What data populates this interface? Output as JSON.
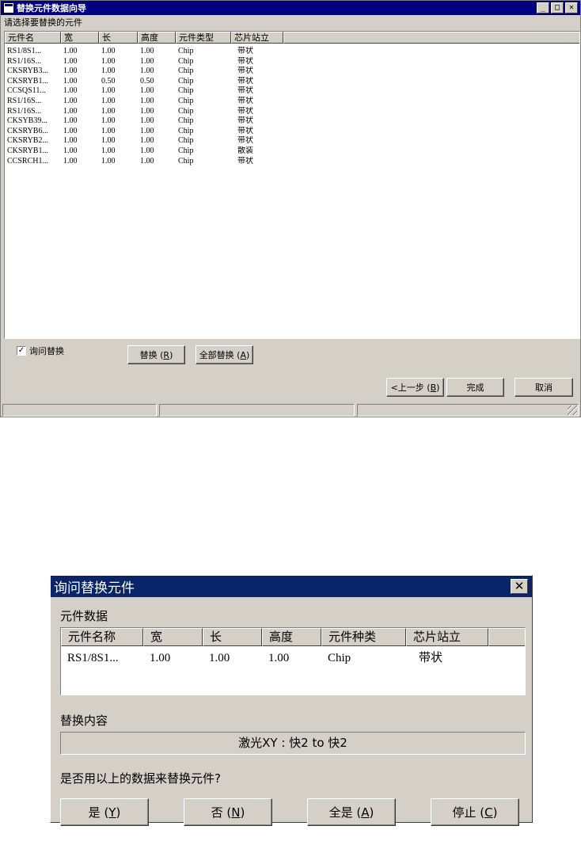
{
  "wizard": {
    "title": "替换元件数据向导",
    "prompt": "请选择要替换的元件",
    "columns": [
      "元件名",
      "宽",
      "长",
      "高度",
      "元件类型",
      "芯片站立"
    ],
    "rows": [
      [
        "RS1/8S1...",
        "1.00",
        "1.00",
        "1.00",
        "Chip",
        "带状"
      ],
      [
        "RS1/16S...",
        "1.00",
        "1.00",
        "1.00",
        "Chip",
        "带状"
      ],
      [
        "CKSRYB3...",
        "1.00",
        "1.00",
        "1.00",
        "Chip",
        "带状"
      ],
      [
        "CKSRYB1...",
        "1.00",
        "0.50",
        "0.50",
        "Chip",
        "带状"
      ],
      [
        "CCSQS11...",
        "1.00",
        "1.00",
        "1.00",
        "Chip",
        "带状"
      ],
      [
        "RS1/16S...",
        "1.00",
        "1.00",
        "1.00",
        "Chip",
        "带状"
      ],
      [
        "RS1/16S...",
        "1.00",
        "1.00",
        "1.00",
        "Chip",
        "带状"
      ],
      [
        "CKSYB39...",
        "1.00",
        "1.00",
        "1.00",
        "Chip",
        "带状"
      ],
      [
        "CKSRYB6...",
        "1.00",
        "1.00",
        "1.00",
        "Chip",
        "带状"
      ],
      [
        "CKSRYB2...",
        "1.00",
        "1.00",
        "1.00",
        "Chip",
        "带状"
      ],
      [
        "CKSRYB1...",
        "1.00",
        "1.00",
        "1.00",
        "Chip",
        "散装"
      ],
      [
        "CCSRCH1...",
        "1.00",
        "1.00",
        "1.00",
        "Chip",
        "带状"
      ]
    ],
    "ask_replace_label": "询问替换",
    "ask_replace_checked": true,
    "replace_label": "替换",
    "replace_key": "R",
    "replace_all_label": "全部替换",
    "replace_all_key": "A",
    "back_label": "<上一步",
    "back_key": "B",
    "finish_label": "完成",
    "cancel_label": "取消"
  },
  "dialog": {
    "title": "询问替换元件",
    "section_data": "元件数据",
    "columns": [
      "元件名称",
      "宽",
      "长",
      "高度",
      "元件种类",
      "芯片站立"
    ],
    "row": [
      "RS1/8S1...",
      "1.00",
      "1.00",
      "1.00",
      "Chip",
      "带状"
    ],
    "section_content": "替换内容",
    "content_value": "激光XY : 快2 to 快2",
    "question": "是否用以上的数据来替换元件?",
    "yes_label": "是",
    "yes_key": "Y",
    "no_label": "否",
    "no_key": "N",
    "yes_all_label": "全是",
    "yes_all_key": "A",
    "stop_label": "停止",
    "stop_key": "C"
  }
}
